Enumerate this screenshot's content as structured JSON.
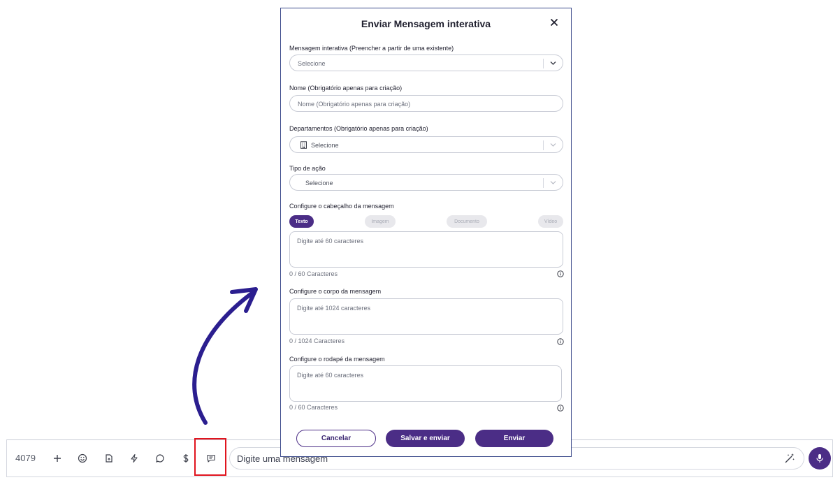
{
  "colors": {
    "primary": "#4b2d86",
    "highlight": "#e0141e",
    "arrow": "#2b1e8f"
  },
  "modal": {
    "title": "Enviar Mensagem interativa",
    "close_icon": "close-icon",
    "existing": {
      "label": "Mensagem interativa (Preencher a partir de uma existente)",
      "value": "Selecione"
    },
    "name": {
      "label": "Nome (Obrigatório apenas para criação)",
      "placeholder": "Nome (Obrigatório apenas para criação)"
    },
    "departments": {
      "label": "Departamentos (Obrigatório apenas para criação)",
      "value": "Selecione",
      "icon": "building-icon"
    },
    "action_type": {
      "label": "Tipo de ação",
      "value": "Selecione"
    },
    "header": {
      "label": "Configure o cabeçalho da mensagem",
      "tabs": [
        "Texto",
        "Imagem",
        "Documento",
        "Vídeo"
      ],
      "active_tab": "Texto",
      "placeholder": "Digite até 60 caracteres",
      "counter": "0 / 60 Caracteres"
    },
    "body": {
      "label": "Configure o corpo da mensagem",
      "placeholder": "Digite até 1024 caracteres",
      "counter": "0 / 1024 Caracteres"
    },
    "footer": {
      "label": "Configure o rodapé da mensagem",
      "placeholder": "Digite até 60 caracteres",
      "counter": "0 / 60 Caracteres"
    },
    "buttons": {
      "cancel": "Cancelar",
      "save_send": "Salvar e enviar",
      "send": "Enviar"
    }
  },
  "chatbar": {
    "ticket_id": "4079",
    "toolbar_icons": [
      "plus-icon",
      "emoji-icon",
      "file-icon",
      "lightning-icon",
      "chat-bubble-icon",
      "dollar-icon",
      "interactive-message-icon"
    ],
    "input_placeholder": "Digite uma mensagem",
    "magic_icon": "magic-wand-icon",
    "mic_icon": "microphone-icon"
  }
}
